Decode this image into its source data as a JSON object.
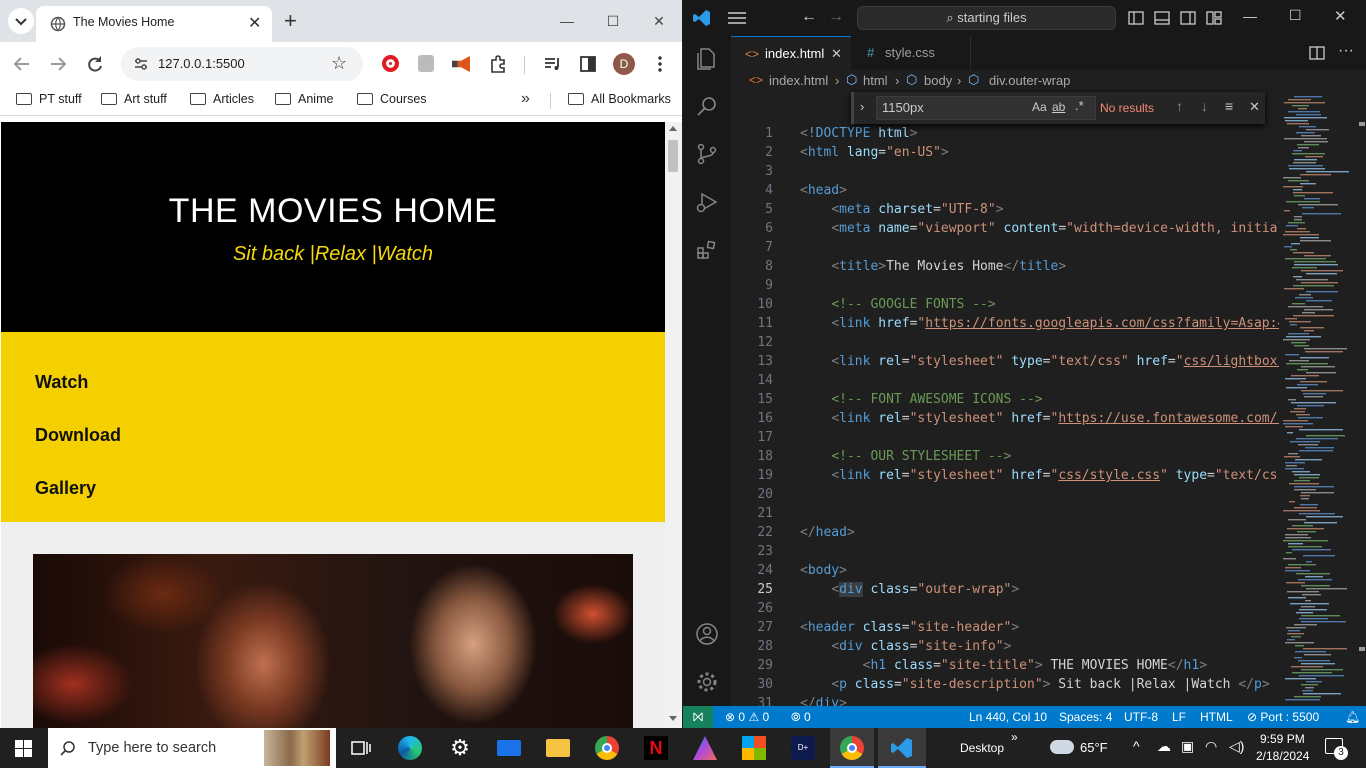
{
  "browser": {
    "tab_title": "The Movies Home",
    "url": "127.0.0.1:5500",
    "bookmarks": [
      "PT stuff",
      "Art stuff",
      "Articles",
      "Anime",
      "Courses"
    ],
    "all_bookmarks": "All Bookmarks",
    "profile_initial": "D"
  },
  "site": {
    "title": "THE MOVIES HOME",
    "description": "Sit back |Relax |Watch",
    "nav": [
      "Watch",
      "Download",
      "Gallery"
    ]
  },
  "vscode": {
    "command_center": "starting files",
    "tabs": [
      {
        "label": "index.html",
        "active": true
      },
      {
        "label": "style.css",
        "active": false
      }
    ],
    "breadcrumb": [
      "index.html",
      "html",
      "body",
      "div.outer-wrap"
    ],
    "find": {
      "query": "1150px",
      "result": "No results"
    },
    "status": {
      "errors": "0",
      "warnings": "0",
      "ports": "0",
      "position": "Ln 440, Col 10",
      "spaces": "Spaces: 4",
      "encoding": "UTF-8",
      "eol": "LF",
      "language": "HTML",
      "port": "Port : 5500"
    },
    "lines": [
      "1",
      "2",
      "3",
      "4",
      "5",
      "6",
      "7",
      "8",
      "9",
      "10",
      "11",
      "12",
      "13",
      "14",
      "15",
      "16",
      "17",
      "18",
      "19",
      "20",
      "21",
      "22",
      "23",
      "24",
      "25",
      "26",
      "27",
      "28",
      "29",
      "30",
      "31"
    ]
  },
  "taskbar": {
    "search_placeholder": "Type here to search",
    "desktop": "Desktop",
    "weather": "65°F",
    "time": "9:59 PM",
    "date": "2/18/2024",
    "notifications": "3"
  },
  "colors": {
    "site_yellow": "#f5d000",
    "vscode_blue": "#007acc",
    "taskbar": "#202020"
  }
}
